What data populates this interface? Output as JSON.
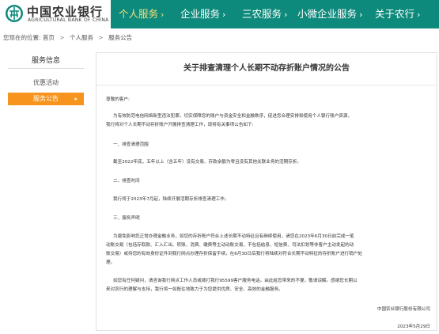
{
  "bank": {
    "name_cn": "中国农业银行",
    "name_en": "AGRICULTURAL BANK OF CHINA"
  },
  "nav": [
    {
      "label": "个人服务",
      "active": true
    },
    {
      "label": "企业服务",
      "active": false
    },
    {
      "label": "三农服务",
      "active": false
    },
    {
      "label": "小微企业服务",
      "active": false
    },
    {
      "label": "关于农行",
      "active": false
    }
  ],
  "nav_chevron": "›",
  "breadcrumb": {
    "prefix": "您现在的位置:",
    "items": [
      "首页",
      "个人服务",
      "服务公告"
    ],
    "separator": ">"
  },
  "sidebar": {
    "title": "服务信息",
    "items": [
      {
        "label": "优惠活动",
        "active": false
      },
      {
        "label": "服务公告",
        "active": true
      }
    ],
    "active_arrow": "▸"
  },
  "notice": {
    "title": "关于排查清理个人长期不动存折账户情况的公告",
    "greeting": "尊敬的客户:",
    "intro_1": "为有效防范电信网络新型违法犯罪，切实保障您的账户与资金安全和金融秩序，促进您合理安排和使用个人银行账户资源，",
    "intro_2": "我行将对个人长期不动存折账户开展排查清理工作，现将有关事项公告如下:",
    "s1_head": "一、排查清理范围",
    "s1_body": "截至2022年底，五年以上（含五年）没有交易、存款余额为零且没有其他关联业务的活期存折。",
    "s2_head": "二、排查时间",
    "s2_body": "我行将于2023年7月起，陆续开展活期存折排查清理工作。",
    "s3_head": "三、服务声明",
    "s3_body_1": "为避免影响您正常办理金融业务，如您的存折账户符合上述长期不动特征且有继续使用，请您在2023年6月30日前完成一笔",
    "s3_body_2": "动账交易（包括存取款、汇入汇出、转账、消费、缴费等主动动账交易，不包括结息、短信费、司法扣划等非客户主动发起的动",
    "s3_body_3": "账交易）或持您的有效身份证件到我行网点办理存折保留手续，在6月30日后我行将陆续对符合长期不动特征的存折账户进行销户处",
    "s3_body_4": "理。",
    "closing_1": "如您有任何疑问，请咨询我行网点工作人员或拨打我行95599客户服务电话。由此给您带来的不便，敬请谅解。感谢您长期以",
    "closing_2": "来对农行的理解与支持，我行将一如既往地致力于为您提供优质、安全、高效的金融服务。",
    "signature": "中国农业银行股份有限公司",
    "date": "2023年5月29日"
  },
  "colors": {
    "brand_green": "#0e8a7c",
    "nav_active": "#f7e07a",
    "sidebar_active": "#f7941e",
    "logo_red": "#c8102e"
  },
  "icons": {
    "logo": "abc-logo-icon"
  }
}
